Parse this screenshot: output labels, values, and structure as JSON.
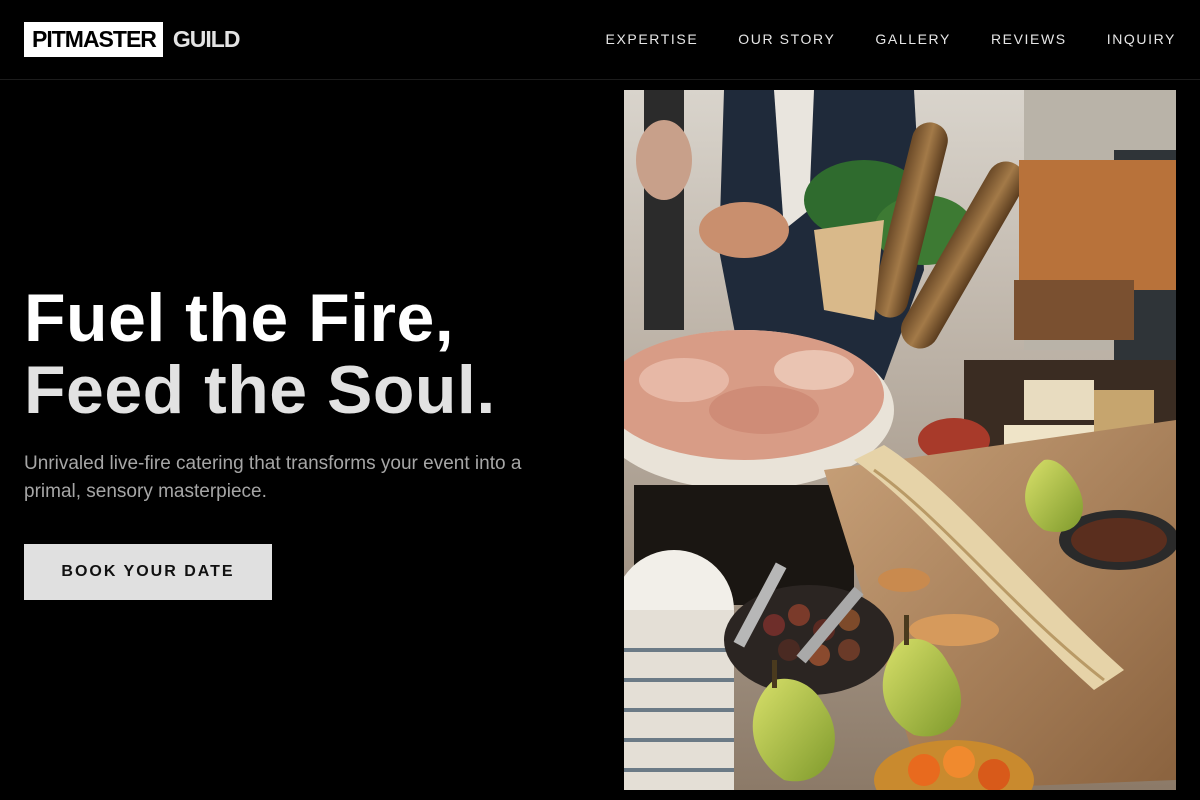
{
  "brand": {
    "logo_box_text": "PITMASTER",
    "logo_text": "GUILD"
  },
  "nav": {
    "items": [
      {
        "label": "EXPERTISE"
      },
      {
        "label": "OUR STORY"
      },
      {
        "label": "GALLERY"
      },
      {
        "label": "REVIEWS"
      },
      {
        "label": "INQUIRY"
      }
    ]
  },
  "hero": {
    "title_line1": "Fuel the Fire,",
    "title_line2": "Feed the Soul.",
    "subtitle": "Unrivaled live-fire catering that transforms your event into a primal, sensory masterpiece.",
    "cta_label": "BOOK YOUR DATE"
  },
  "colors": {
    "background": "#000000",
    "accent_button": "#e0e0e0",
    "subtitle_text": "#a6a6a6"
  }
}
